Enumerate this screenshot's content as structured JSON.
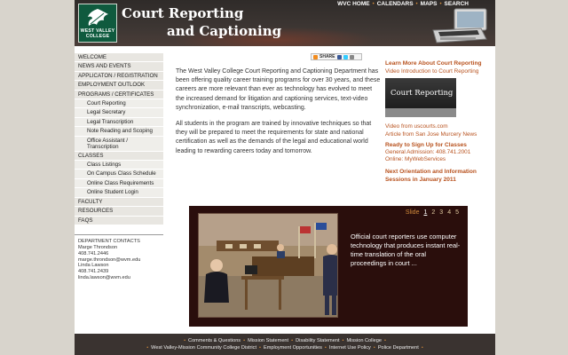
{
  "header": {
    "logo_line1": "WEST VALLEY",
    "logo_line2": "COLLEGE",
    "title_line1": "Court Reporting",
    "title_line2": "and Captioning",
    "nav": [
      "WVC HOME",
      "CALENDARS",
      "MAPS",
      "SEARCH"
    ],
    "separator": "•"
  },
  "sidebar": {
    "items": [
      {
        "label": "WELCOME",
        "level": 1
      },
      {
        "label": "NEWS AND EVENTS",
        "level": 1
      },
      {
        "label": "APPLICATON / REGISTRATION",
        "level": 1
      },
      {
        "label": "EMPLOYMENT OUTLOOK",
        "level": 1
      },
      {
        "label": "PROGRAMS / CERTIFICATES",
        "level": 1
      },
      {
        "label": "Court Reporting",
        "level": 2
      },
      {
        "label": "Legal Secretary",
        "level": 2
      },
      {
        "label": "Legal Transcription",
        "level": 2
      },
      {
        "label": "Note Reading and Scoping",
        "level": 2
      },
      {
        "label": "Office Assistant / Transcription",
        "level": 2
      },
      {
        "label": "CLASSES",
        "level": 1
      },
      {
        "label": "Class Listings",
        "level": 2
      },
      {
        "label": "On Campus Class Schedule",
        "level": 2
      },
      {
        "label": "Online Class Requirements",
        "level": 2
      },
      {
        "label": "Online Student Login",
        "level": 2
      },
      {
        "label": "FACULTY",
        "level": 1
      },
      {
        "label": "RESOURCES",
        "level": 1
      },
      {
        "label": "FAQs",
        "level": 1
      }
    ],
    "dept_title": "DEPARTMENT CONTACTS",
    "contacts": [
      "Marge Throndson",
      "408.741.2446",
      "marge.throndson@wvm.edu",
      "Linda Lawson",
      "408.741.2439",
      "linda.lawson@wvm.edu"
    ]
  },
  "share": {
    "label": "SHARE"
  },
  "main": {
    "para1": "The West Valley College Court Reporting and Captioning Department has been offering quality career training programs for over 30 years, and these careers are more relevant than ever as technology has evolved to meet the increased demand for litigation and captioning services, text-video synchronization, e-mail transcripts, webcasting.",
    "para2": "All students in the program are trained by innovative techniques so that they will be prepared to meet the requirements for state and national certification as well as the demands of the legal and educational world leading to rewarding careers today and tomorrow."
  },
  "right": {
    "learn_more": "Learn More About Court Reporting",
    "video_intro": "Video Introduction to Court Reporting",
    "thumb_text": "Court Reporting",
    "video_source": "Video from uscourts.com",
    "article": "Article from San Jose Murcery News",
    "signup_head": "Ready to Sign Up for Classes",
    "general_admission": "General Admission: 408.741.2001",
    "online": "Online: MyWebServices",
    "orientation": "Next Orientation and Information Sessions in January 2011"
  },
  "slideshow": {
    "label": "Slide",
    "numbers": [
      "1",
      "2",
      "3",
      "4",
      "5"
    ],
    "active": "1",
    "caption": "Official court reporters use computer technology that produces instant  real-time translation of the oral proceedings in court ..."
  },
  "footer": {
    "row1": [
      "Comments & Questions",
      "Mission Statement",
      "Disability Statement",
      "Mission College"
    ],
    "row2": [
      "West Valley-Mission Community College District",
      "Employment Opportunities",
      "Internet Use Policy",
      "Police Department"
    ]
  },
  "colors": {
    "accent": "#b8521e",
    "header_bg": "#2f2b29",
    "slide_bg": "#2a0e0c",
    "logo_green": "#0f5a3e"
  }
}
